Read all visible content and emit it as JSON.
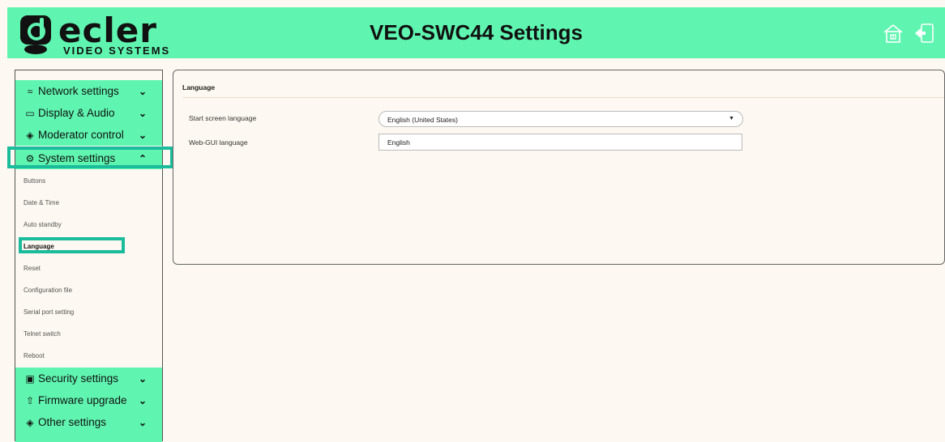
{
  "header": {
    "logo_text": "ecler",
    "logo_subtitle": "VIDEO SYSTEMS",
    "title": "VEO-SWC44 Settings",
    "icons": [
      "home-icon",
      "logout-icon"
    ]
  },
  "sidebar": {
    "sections": [
      {
        "label": "Network settings",
        "icon": "wifi-icon",
        "expanded": false
      },
      {
        "label": "Display & Audio",
        "icon": "monitor-icon",
        "expanded": false
      },
      {
        "label": "Moderator control",
        "icon": "diamond-icon",
        "expanded": false
      },
      {
        "label": "System settings",
        "icon": "gear-icon",
        "expanded": true
      },
      {
        "label": "Security settings",
        "icon": "lock-icon",
        "expanded": false
      },
      {
        "label": "Firmware upgrade",
        "icon": "upload-icon",
        "expanded": false
      },
      {
        "label": "Other settings",
        "icon": "diamond-icon",
        "expanded": false
      }
    ],
    "system_subitems": [
      "Buttons",
      "Date & Time",
      "Auto standby",
      "Language",
      "Reset",
      "Configuration file",
      "Serial port setting",
      "Telnet switch",
      "Reboot"
    ],
    "active_subitem": "Language"
  },
  "panel": {
    "title": "Language",
    "fields": [
      {
        "label": "Start screen language",
        "type": "select",
        "value": "English (United States)"
      },
      {
        "label": "Web-GUI language",
        "type": "text",
        "value": "English"
      }
    ]
  },
  "colors": {
    "accent": "#5ff5b0",
    "highlight": "#1abc9c",
    "background": "#fdf8f1"
  }
}
